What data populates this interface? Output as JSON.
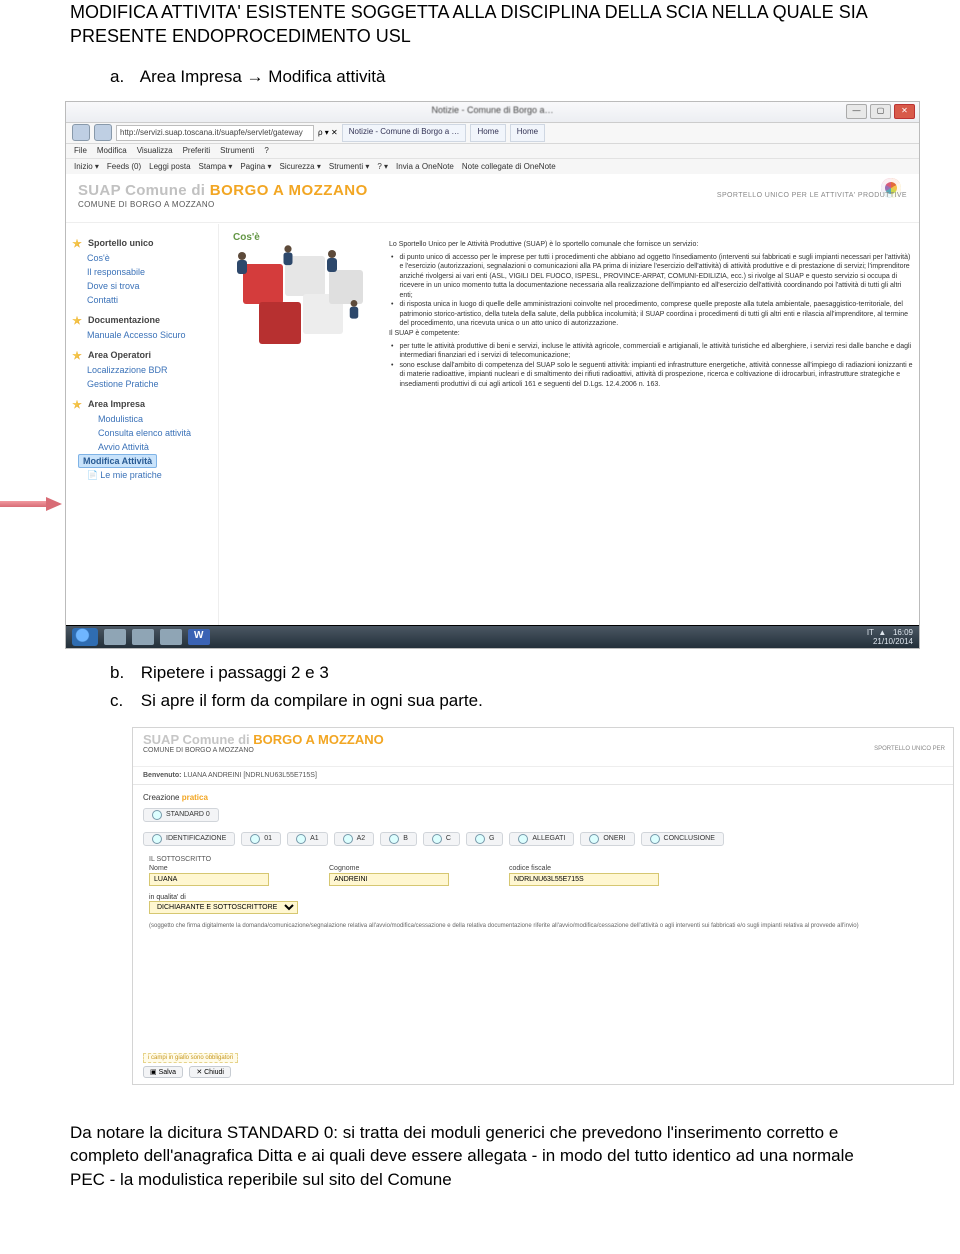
{
  "doc": {
    "title": "MODIFICA ATTIVITA' ESISTENTE SOGGETTA ALLA DISCIPLINA DELLA SCIA NELLA QUALE SIA PRESENTE ENDOPROCEDIMENTO USL",
    "item_a": "Area Impresa → Modifica attività",
    "item_b": "Ripetere i passaggi 2 e 3",
    "item_c": "Si apre il form da compilare in ogni sua parte.",
    "footer": "Da notare la dicitura STANDARD 0: si tratta dei moduli generici che prevedono l'inserimento corretto e completo dell'anagrafica Ditta e ai quali deve essere allegata - in modo del tutto identico ad una normale PEC - la modulistica reperibile sul sito del Comune"
  },
  "shot1": {
    "titlebar": "Notizie - Comune di Borgo a…",
    "url": "http://servizi.suap.toscana.it/suapfe/servlet/gateway",
    "search_hint": "ρ ▾ ✕",
    "tab1": "Notizie - Comune di Borgo a …",
    "tab2": "Home",
    "tab3": "Home",
    "menu": [
      "File",
      "Modifica",
      "Visualizza",
      "Preferiti",
      "Strumenti",
      "?"
    ],
    "toolbar": [
      "Inizio ▾",
      "Feeds (0)",
      "Leggi posta",
      "Stampa ▾",
      "Pagina ▾",
      "Sicurezza ▾",
      "Strumenti ▾",
      "? ▾",
      "Invia a OneNote",
      "Note collegate di OneNote"
    ],
    "brand_prefix": "SUAP Comune di ",
    "brand_name": "BORGO A MOZZANO",
    "brand_sub": "COMUNE DI BORGO A MOZZANO",
    "brand_right": "SPORTELLO UNICO PER LE ATTIVITA' PRODUTTIVE",
    "sidebar": {
      "sec1": "Sportello unico",
      "s1_items": [
        "Cos'è",
        "Il responsabile",
        "Dove si trova",
        "Contatti"
      ],
      "sec2": "Documentazione",
      "s2_items": [
        "Manuale Accesso Sicuro"
      ],
      "sec3": "Area Operatori",
      "s3_items": [
        "Localizzazione BDR",
        "Gestione Pratiche"
      ],
      "sec4": "Area Impresa",
      "s4_items": [
        "Modulistica",
        "Consulta elenco attività",
        "Avvio Attività",
        "Modifica Attività",
        "Le mie pratiche"
      ]
    },
    "content": {
      "heading": "Cos'è",
      "p1": "Lo Sportello Unico per le Attività Produttive (SUAP) è lo sportello comunale che fornisce un servizio:",
      "b1": "di punto unico di accesso per le imprese per tutti i procedimenti che abbiano ad oggetto l'insediamento (interventi sui fabbricati e sugli impianti necessari per l'attività) e l'esercizio (autorizzazioni, segnalazioni o comunicazioni alla PA prima di iniziare l'esercizio dell'attività) di attività produttive e di prestazione di servizi; l'imprenditore anziché rivolgersi ai vari enti (ASL, VIGILI DEL FUOCO, ISPESL, PROVINCE-ARPAT, COMUNI-EDILIZIA, ecc.) si rivolge al SUAP e questo servizio si occupa di ricevere in un unico momento tutta la documentazione necessaria alla realizzazione dell'impianto ed all'esercizio dell'attività coordinando poi l'attività di tutti gli altri enti;",
      "b2": "di risposta unica in luogo di quelle delle amministrazioni coinvolte nel procedimento, comprese quelle preposte alla tutela ambientale, paesaggistico-territoriale, del patrimonio storico-artistico, della tutela della salute, della pubblica incolumità; il SUAP coordina i procedimenti di tutti gli altri enti e rilascia all'imprenditore, al termine del procedimento, una ricevuta unica o un atto unico di autorizzazione.",
      "p2": "Il SUAP è competente:",
      "b3": "per tutte le attività produttive di beni e servizi, incluse le attività agricole, commerciali e artigianali, le attività turistiche ed alberghiere, i servizi resi dalle banche e dagli intermediari finanziari ed i servizi di telecomunicazione;",
      "b4": "sono escluse dall'ambito di competenza del SUAP solo le seguenti attività: impianti ed infrastrutture energetiche, attività connesse all'impiego di radiazioni ionizzanti e di materie radioattive, impianti nucleari e di smaltimento dei rifiuti radioattivi, attività di prospezione, ricerca e coltivazione di idrocarburi, infrastrutture strategiche e insediamenti produttivi di cui agli articoli 161 e seguenti del D.Lgs. 12.4.2006 n. 163."
    },
    "taskbar": {
      "lang": "IT",
      "time": "16:09",
      "date": "21/10/2014"
    }
  },
  "shot2": {
    "brand_prefix": "SUAP Comune di ",
    "brand_name": "BORGO A MOZZANO",
    "brand_sub": "COMUNE DI BORGO A MOZZANO",
    "brand_right": "SPORTELLO UNICO PER",
    "benvenuto_label": "Benvenuto: ",
    "benvenuto_value": "LUANA ANDREINI [NDRLNU63L55E715S]",
    "creazione": "Creazione ",
    "pratica": "pratica",
    "tab_standard": "STANDARD 0",
    "id_tabs": [
      "IDENTIFICAZIONE",
      "01",
      "A1",
      "A2",
      "B",
      "C",
      "G",
      "ALLEGATI",
      "ONERI",
      "CONCLUSIONE"
    ],
    "form": {
      "sottoscritto": "IL SOTTOSCRITTO",
      "nome_label": "Nome",
      "nome_value": "LUANA",
      "cognome_label": "Cognome",
      "cognome_value": "ANDREINI",
      "cf_label": "codice fiscale",
      "cf_value": "NDRLNU63L55E715S",
      "qualita_label": "in qualita' di",
      "qualita_value": "DICHIARANTE E SOTTOSCRITTORE",
      "note": "(soggetto che firma digitalmente la domanda/comunicazione/segnalazione relativa all'avvio/modifica/cessazione e della relativa documentazione riferite all'avvio/modifica/cessazione dell'attività o agli interventi sui fabbricati e/o sugli impianti relativa al provvede all'invio)"
    },
    "bottom": {
      "hint": "i campi in giallo sono obbligatori",
      "save": "Salva",
      "close": "Chiudi"
    }
  }
}
